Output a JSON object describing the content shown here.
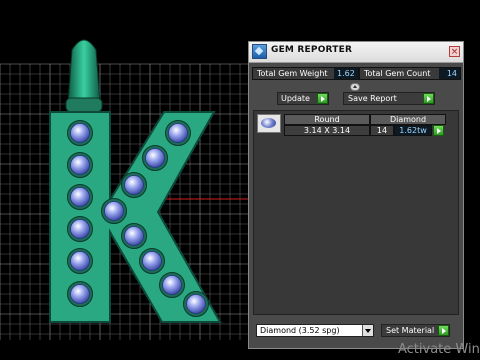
{
  "window": {
    "title": "GEM REPORTER",
    "close_glyph": "×"
  },
  "stats": {
    "weight_label": "Total Gem Weight",
    "weight_value": "1.62",
    "count_label": "Total Gem Count",
    "count_value": "14"
  },
  "toolbar": {
    "update_label": "Update",
    "save_report_label": "Save Report"
  },
  "gem_table": {
    "headers": [
      "Round",
      "Diamond"
    ],
    "rows": [
      {
        "size": "3.14 X 3.14",
        "qty": "14",
        "ctw": "1.62tw"
      }
    ]
  },
  "material": {
    "selected": "Diamond    (3.52 spg)",
    "set_label": "Set Material"
  },
  "watermark": "Activate Win",
  "colors": {
    "pendant": "#2aa882",
    "gem": "#7f8fe0",
    "panel_bg": "#4a4a4a",
    "accent_green": "#3fb82e",
    "value_text": "#9fd6ff"
  },
  "icons": [
    "gem-reporter-app-icon",
    "close-icon",
    "collapse-icon",
    "play-arrow-icon",
    "round-gem-icon",
    "dropdown-arrow-icon"
  ]
}
